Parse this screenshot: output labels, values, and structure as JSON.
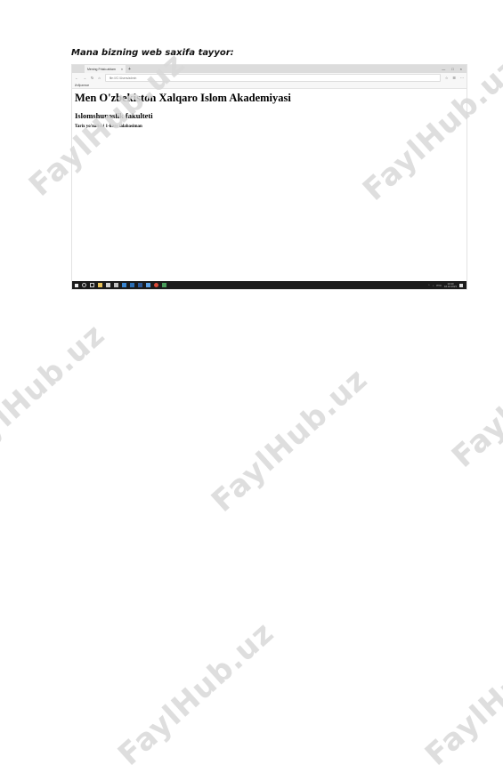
{
  "caption": "Mana bizning web saxifa tayyor:",
  "watermark_text": "FaylHub.uz",
  "browser": {
    "tab_title": "Mening Frtalo.ablam",
    "tab_close": "×",
    "new_tab": "+",
    "url": "file:///C:/Users/admin",
    "favorites_label": "Избранное",
    "window_controls": [
      "—",
      "□",
      "×"
    ]
  },
  "page": {
    "heading": "Men O'zbekiston Xalqaro Islom Akademiyasi",
    "subheading": "Islomshunoslik fakulteti",
    "paragraph": "Tarix yo'nalishi 1-kurs talabasiman"
  },
  "taskbar": {
    "lang": "РУС",
    "time": "13:40",
    "date": "16.10.2021"
  },
  "colors": {
    "taskbar": "#1b1b1b",
    "watermark": "#d9d9d9"
  }
}
